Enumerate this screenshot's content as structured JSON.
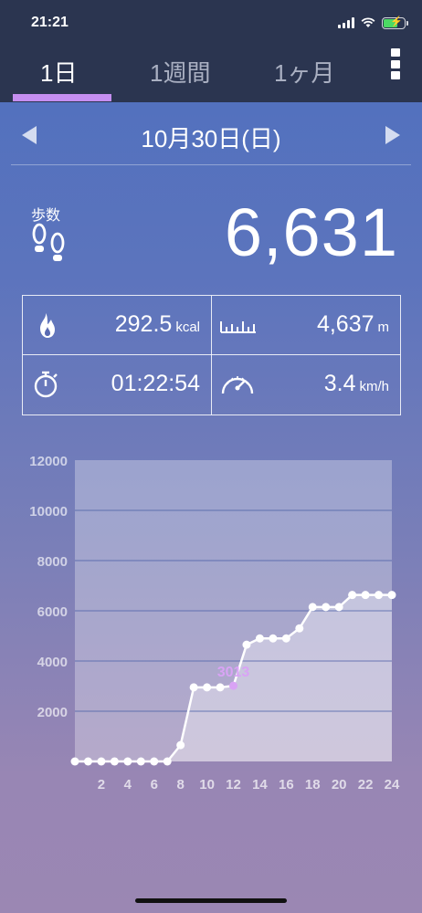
{
  "status": {
    "time": "21:21"
  },
  "tabs": [
    {
      "label": "1日",
      "active": true
    },
    {
      "label": "1週間",
      "active": false
    },
    {
      "label": "1ヶ月",
      "active": false
    }
  ],
  "date": "10月30日(日)",
  "steps": {
    "label": "歩数",
    "value": "6,631"
  },
  "stats": {
    "calories": {
      "value": "292.5",
      "unit": "kcal",
      "icon": "flame-icon"
    },
    "distance": {
      "value": "4,637",
      "unit": "m",
      "icon": "ruler-icon"
    },
    "duration": {
      "value": "01:22:54",
      "unit": "",
      "icon": "stopwatch-icon"
    },
    "speed": {
      "value": "3.4",
      "unit": "km/h",
      "icon": "speedometer-icon"
    }
  },
  "colors": {
    "accent": "#c58ef0",
    "highlight_point": "#d9a3f5",
    "header_bg": "#2b3550"
  },
  "chart_data": {
    "type": "line",
    "x": [
      0,
      1,
      2,
      3,
      4,
      5,
      6,
      7,
      8,
      9,
      10,
      11,
      12,
      13,
      14,
      15,
      16,
      17,
      18,
      19,
      20,
      21,
      22,
      23,
      24
    ],
    "y": [
      0,
      0,
      0,
      0,
      0,
      0,
      0,
      0,
      650,
      2950,
      2950,
      2950,
      3013,
      4650,
      4900,
      4900,
      4900,
      5300,
      6150,
      6150,
      6150,
      6631,
      6631,
      6631,
      6631
    ],
    "xticks": [
      "2",
      "4",
      "6",
      "8",
      "10",
      "12",
      "14",
      "16",
      "18",
      "20",
      "22",
      "24"
    ],
    "yticks": [
      "2000",
      "4000",
      "6000",
      "8000",
      "10000",
      "12000"
    ],
    "ylim": [
      0,
      12000
    ],
    "xlim": [
      0,
      24
    ],
    "highlight": {
      "x": 12,
      "label": "3013"
    },
    "grid": true
  }
}
